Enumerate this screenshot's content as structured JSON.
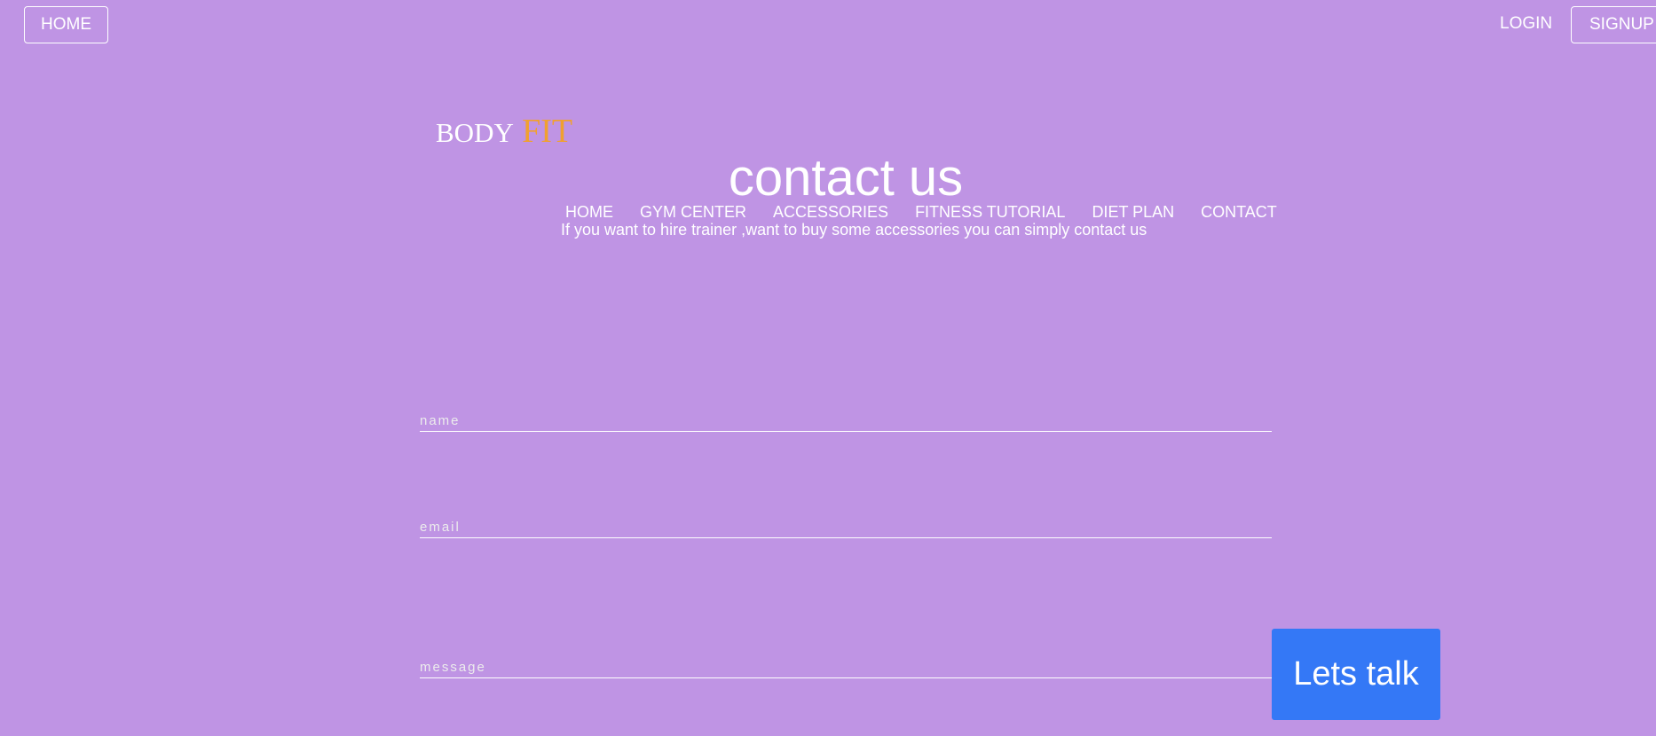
{
  "topbar": {
    "home_label": "HOME",
    "login_label": "LOGIN",
    "signup_label": "SIGNUP"
  },
  "logo": {
    "part1": "BODY",
    "part2": "FIT"
  },
  "page": {
    "title": "contact us",
    "subtitle": "If you want to hire trainer ,want to buy some accessories you can simply contact us"
  },
  "nav": {
    "items": [
      {
        "label": "HOME"
      },
      {
        "label": "GYM CENTER"
      },
      {
        "label": "ACCESSORIES"
      },
      {
        "label": "FITNESS TUTORIAL"
      },
      {
        "label": "DIET PLAN"
      },
      {
        "label": "CONTACT"
      }
    ]
  },
  "form": {
    "name_placeholder": "name",
    "email_placeholder": "email",
    "message_placeholder": "message",
    "submit_label": "Lets talk"
  },
  "colors": {
    "background": "#bf94e4",
    "accent": "#f0a030",
    "button": "#3478f6"
  }
}
